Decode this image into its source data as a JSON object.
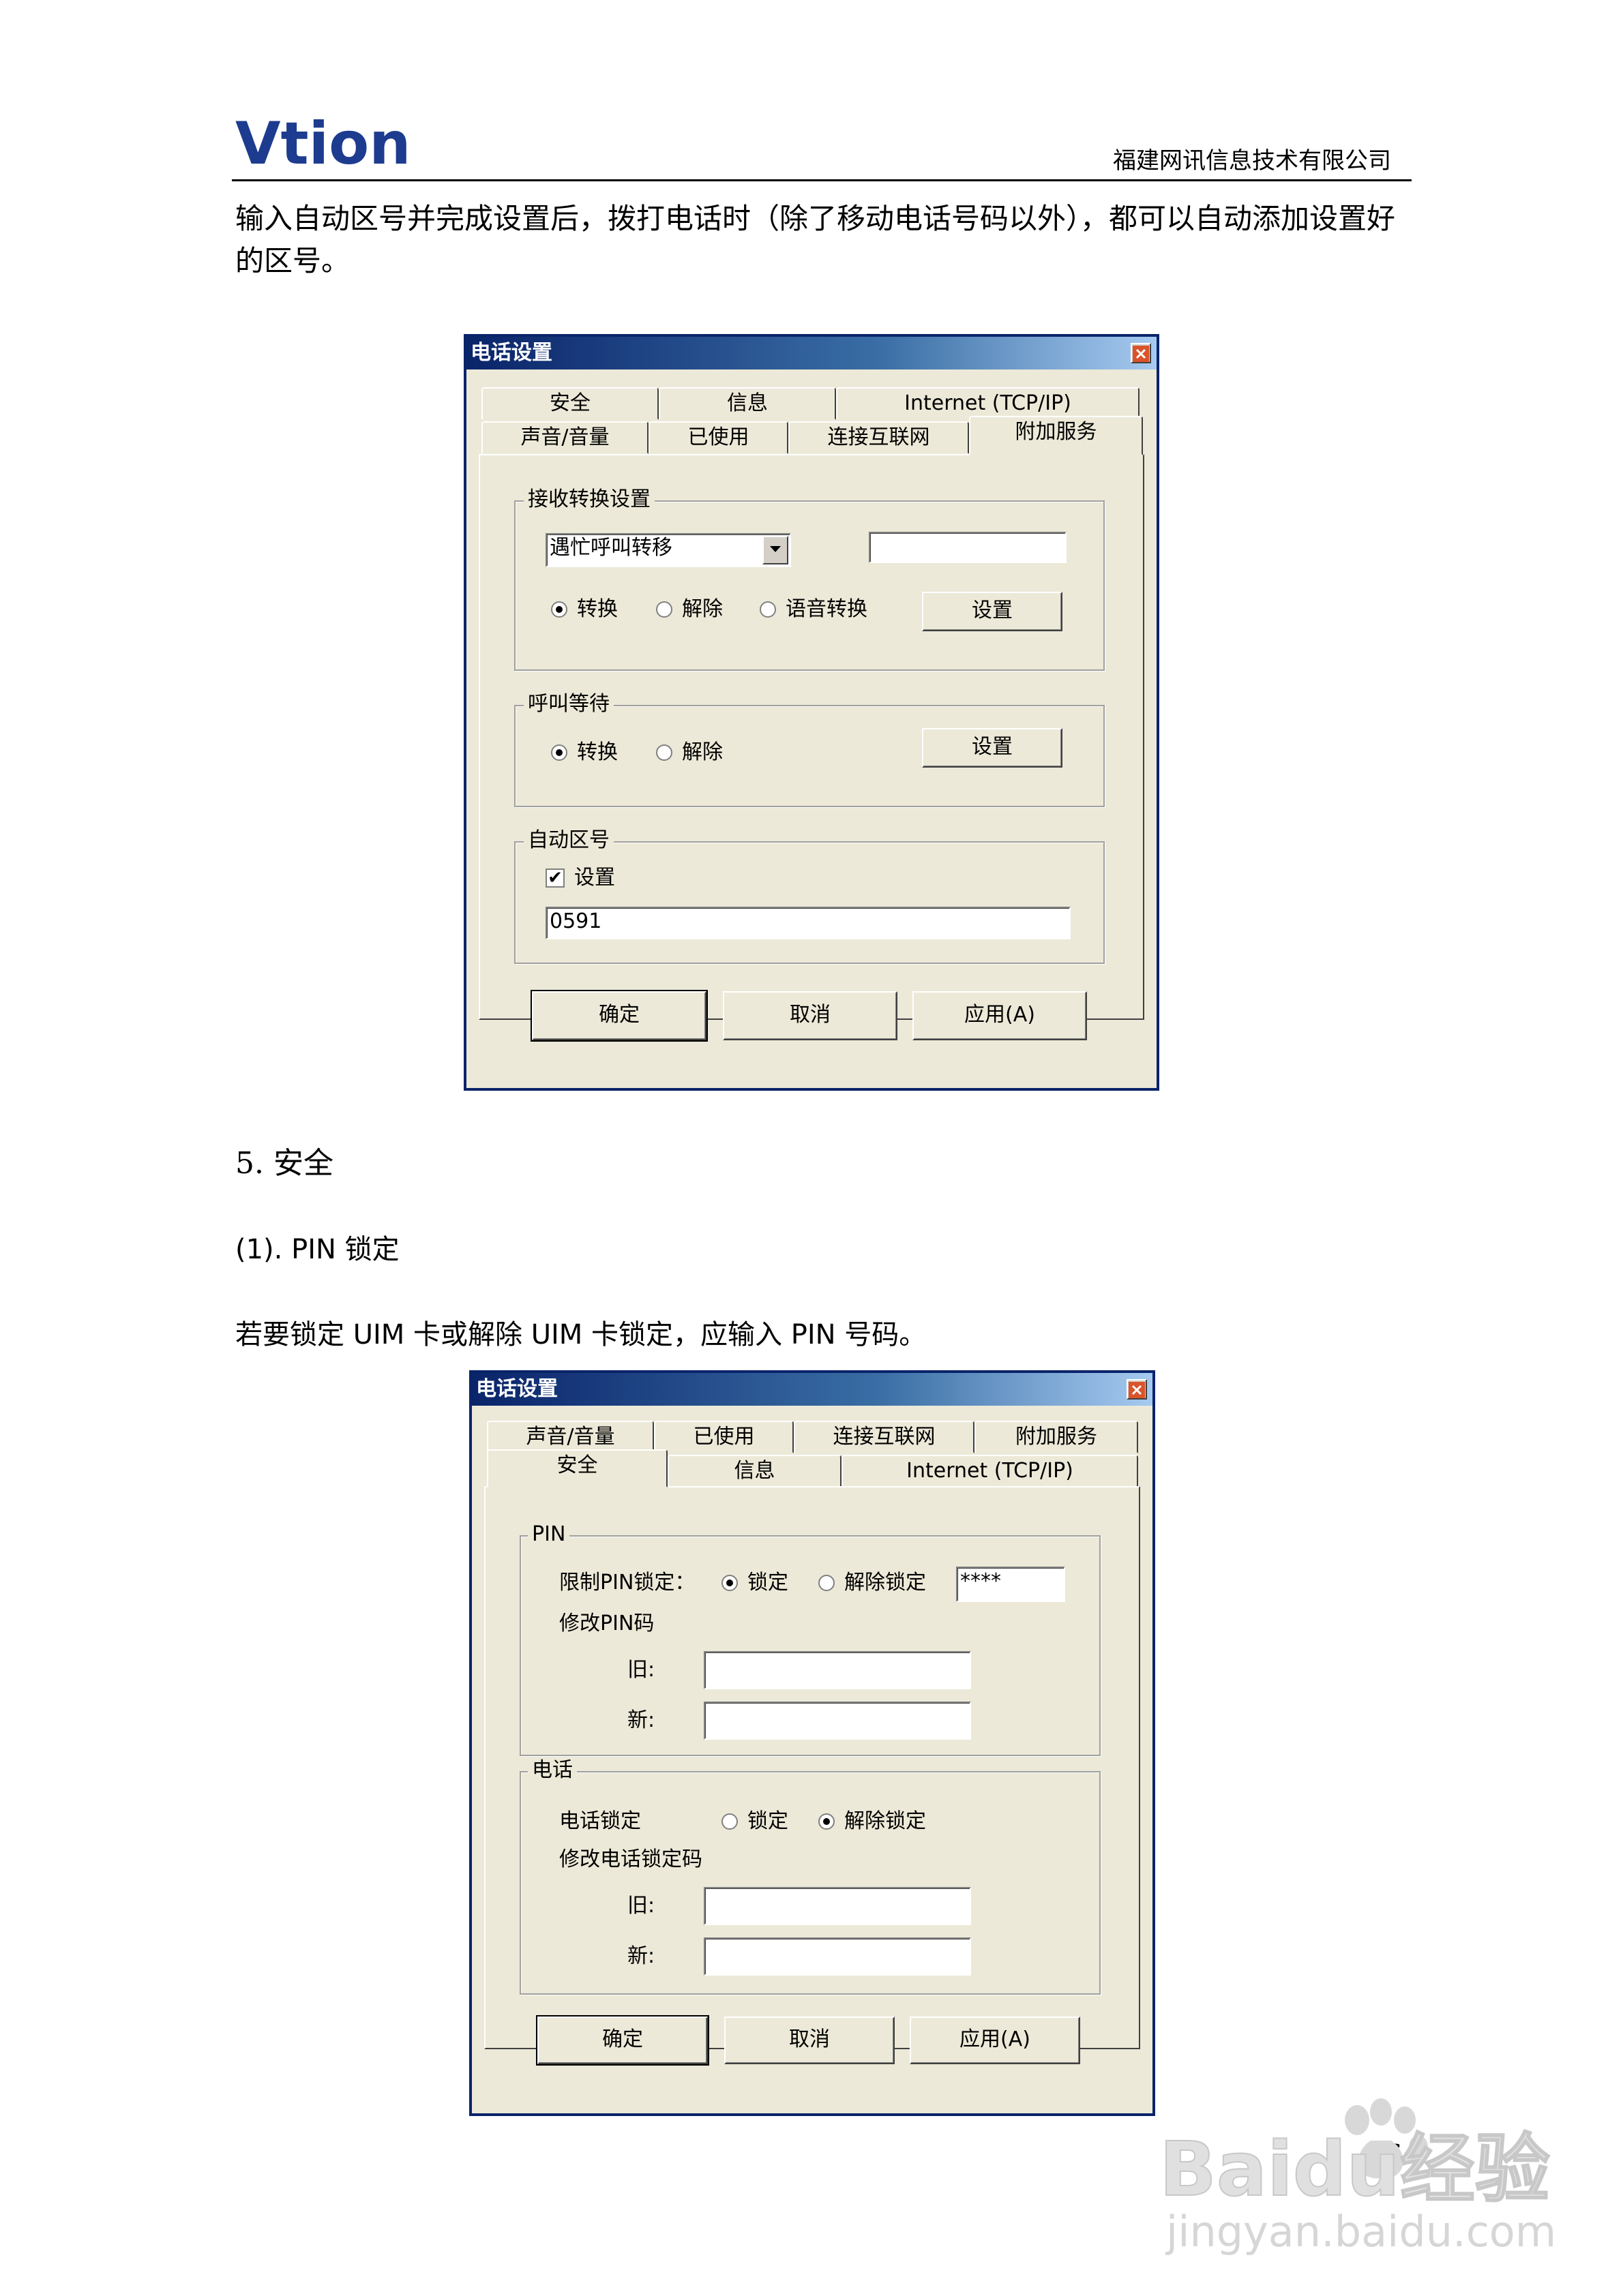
{
  "header": {
    "logo_text": "Vtion",
    "company": "福建网讯信息技术有限公司"
  },
  "intro_paragraph": "输入自动区号并完成设置后，拨打电话时（除了移动电话号码以外），都可以自动添加设置好的区号。",
  "dialog1": {
    "title": "电话设置",
    "tabs_row1": [
      "安全",
      "信息",
      "Internet (TCP/IP)"
    ],
    "tabs_row2": [
      "声音/音量",
      "已使用",
      "连接互联网",
      "附加服务"
    ],
    "active_tab": "附加服务",
    "group_forward": {
      "label": "接收转换设置",
      "dropdown_value": "遇忙呼叫转移",
      "text_value": "",
      "radio1": "转换",
      "radio2": "解除",
      "radio3": "语音转换",
      "button": "设置"
    },
    "group_waiting": {
      "label": "呼叫等待",
      "radio1": "转换",
      "radio2": "解除",
      "button": "设置"
    },
    "group_areacode": {
      "label": "自动区号",
      "checkbox_label": "设置",
      "checkbox_mark": "✔",
      "value": "0591"
    },
    "buttons": {
      "ok": "确定",
      "cancel": "取消",
      "apply": "应用(A)"
    }
  },
  "section5_heading": "5. 安全",
  "subsection_heading": "(1). PIN 锁定",
  "section5_text": "若要锁定 UIM 卡或解除 UIM 卡锁定，应输入 PIN 号码。",
  "dialog2": {
    "title": "电话设置",
    "tabs_row1": [
      "声音/音量",
      "已使用",
      "连接互联网",
      "附加服务"
    ],
    "tabs_row2": [
      "安全",
      "信息",
      "Internet (TCP/IP)"
    ],
    "active_tab": "安全",
    "group_pin": {
      "label": "PIN",
      "restrict_label": "限制PIN锁定：",
      "radio_lock": "锁定",
      "radio_unlock": "解除锁定",
      "pin_value": "****",
      "change_label": "修改PIN码",
      "old_label": "旧:",
      "new_label": "新:",
      "old_value": "",
      "new_value": ""
    },
    "group_phone": {
      "label": "电话",
      "lock_label": "电话锁定",
      "radio_lock": "锁定",
      "radio_unlock": "解除锁定",
      "change_label": "修改电话锁定码",
      "old_label": "旧:",
      "new_label": "新:",
      "old_value": "",
      "new_value": ""
    },
    "buttons": {
      "ok": "确定",
      "cancel": "取消",
      "apply": "应用(A)"
    }
  },
  "page_number": "26",
  "watermark": {
    "text": "Baidu经验",
    "url_text": "jingyan.baidu.com"
  }
}
